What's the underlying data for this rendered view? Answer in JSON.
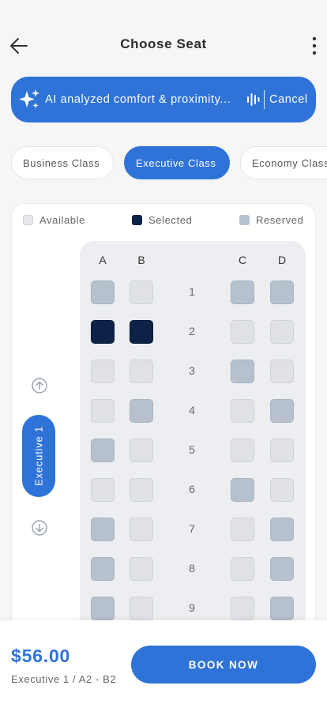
{
  "header": {
    "title": "Choose Seat",
    "back_icon": "arrow-left-icon",
    "menu_icon": "more-vertical-icon"
  },
  "ai_banner": {
    "text": "AI analyzed comfort & proximity...",
    "cancel_label": "Cancel",
    "sparkle_icon": "sparkle-icon",
    "voice_icon": "voice-wave-icon"
  },
  "class_tabs": [
    {
      "label": "Business Class",
      "active": false
    },
    {
      "label": "Executive Class",
      "active": true
    },
    {
      "label": "Economy Class",
      "active": false
    }
  ],
  "legend": {
    "available": "Available",
    "selected": "Selected",
    "reserved": "Reserved"
  },
  "columns": [
    "A",
    "B",
    "C",
    "D"
  ],
  "deck": {
    "label": "Executive 1",
    "up_icon": "arrow-up-circle-icon",
    "down_icon": "arrow-down-circle-icon"
  },
  "seat_rows": [
    {
      "row": "1",
      "seats": [
        "reserved",
        "available",
        "reserved",
        "reserved"
      ]
    },
    {
      "row": "2",
      "seats": [
        "selected",
        "selected",
        "available",
        "available"
      ]
    },
    {
      "row": "3",
      "seats": [
        "available",
        "available",
        "reserved",
        "available"
      ]
    },
    {
      "row": "4",
      "seats": [
        "available",
        "reserved",
        "available",
        "reserved"
      ]
    },
    {
      "row": "5",
      "seats": [
        "reserved",
        "available",
        "available",
        "available"
      ]
    },
    {
      "row": "6",
      "seats": [
        "available",
        "available",
        "reserved",
        "available"
      ]
    },
    {
      "row": "7",
      "seats": [
        "reserved",
        "available",
        "available",
        "reserved"
      ]
    },
    {
      "row": "8",
      "seats": [
        "reserved",
        "available",
        "available",
        "reserved"
      ]
    },
    {
      "row": "9",
      "seats": [
        "reserved",
        "available",
        "available",
        "reserved"
      ]
    }
  ],
  "footer": {
    "price": "$56.00",
    "summary": "Executive 1 / A2 - B2",
    "book_label": "BOOK NOW"
  },
  "colors": {
    "primary": "#2f73d8",
    "selected": "#0c2347",
    "reserved": "#b7c1cd",
    "available": "#dfe1e5"
  }
}
